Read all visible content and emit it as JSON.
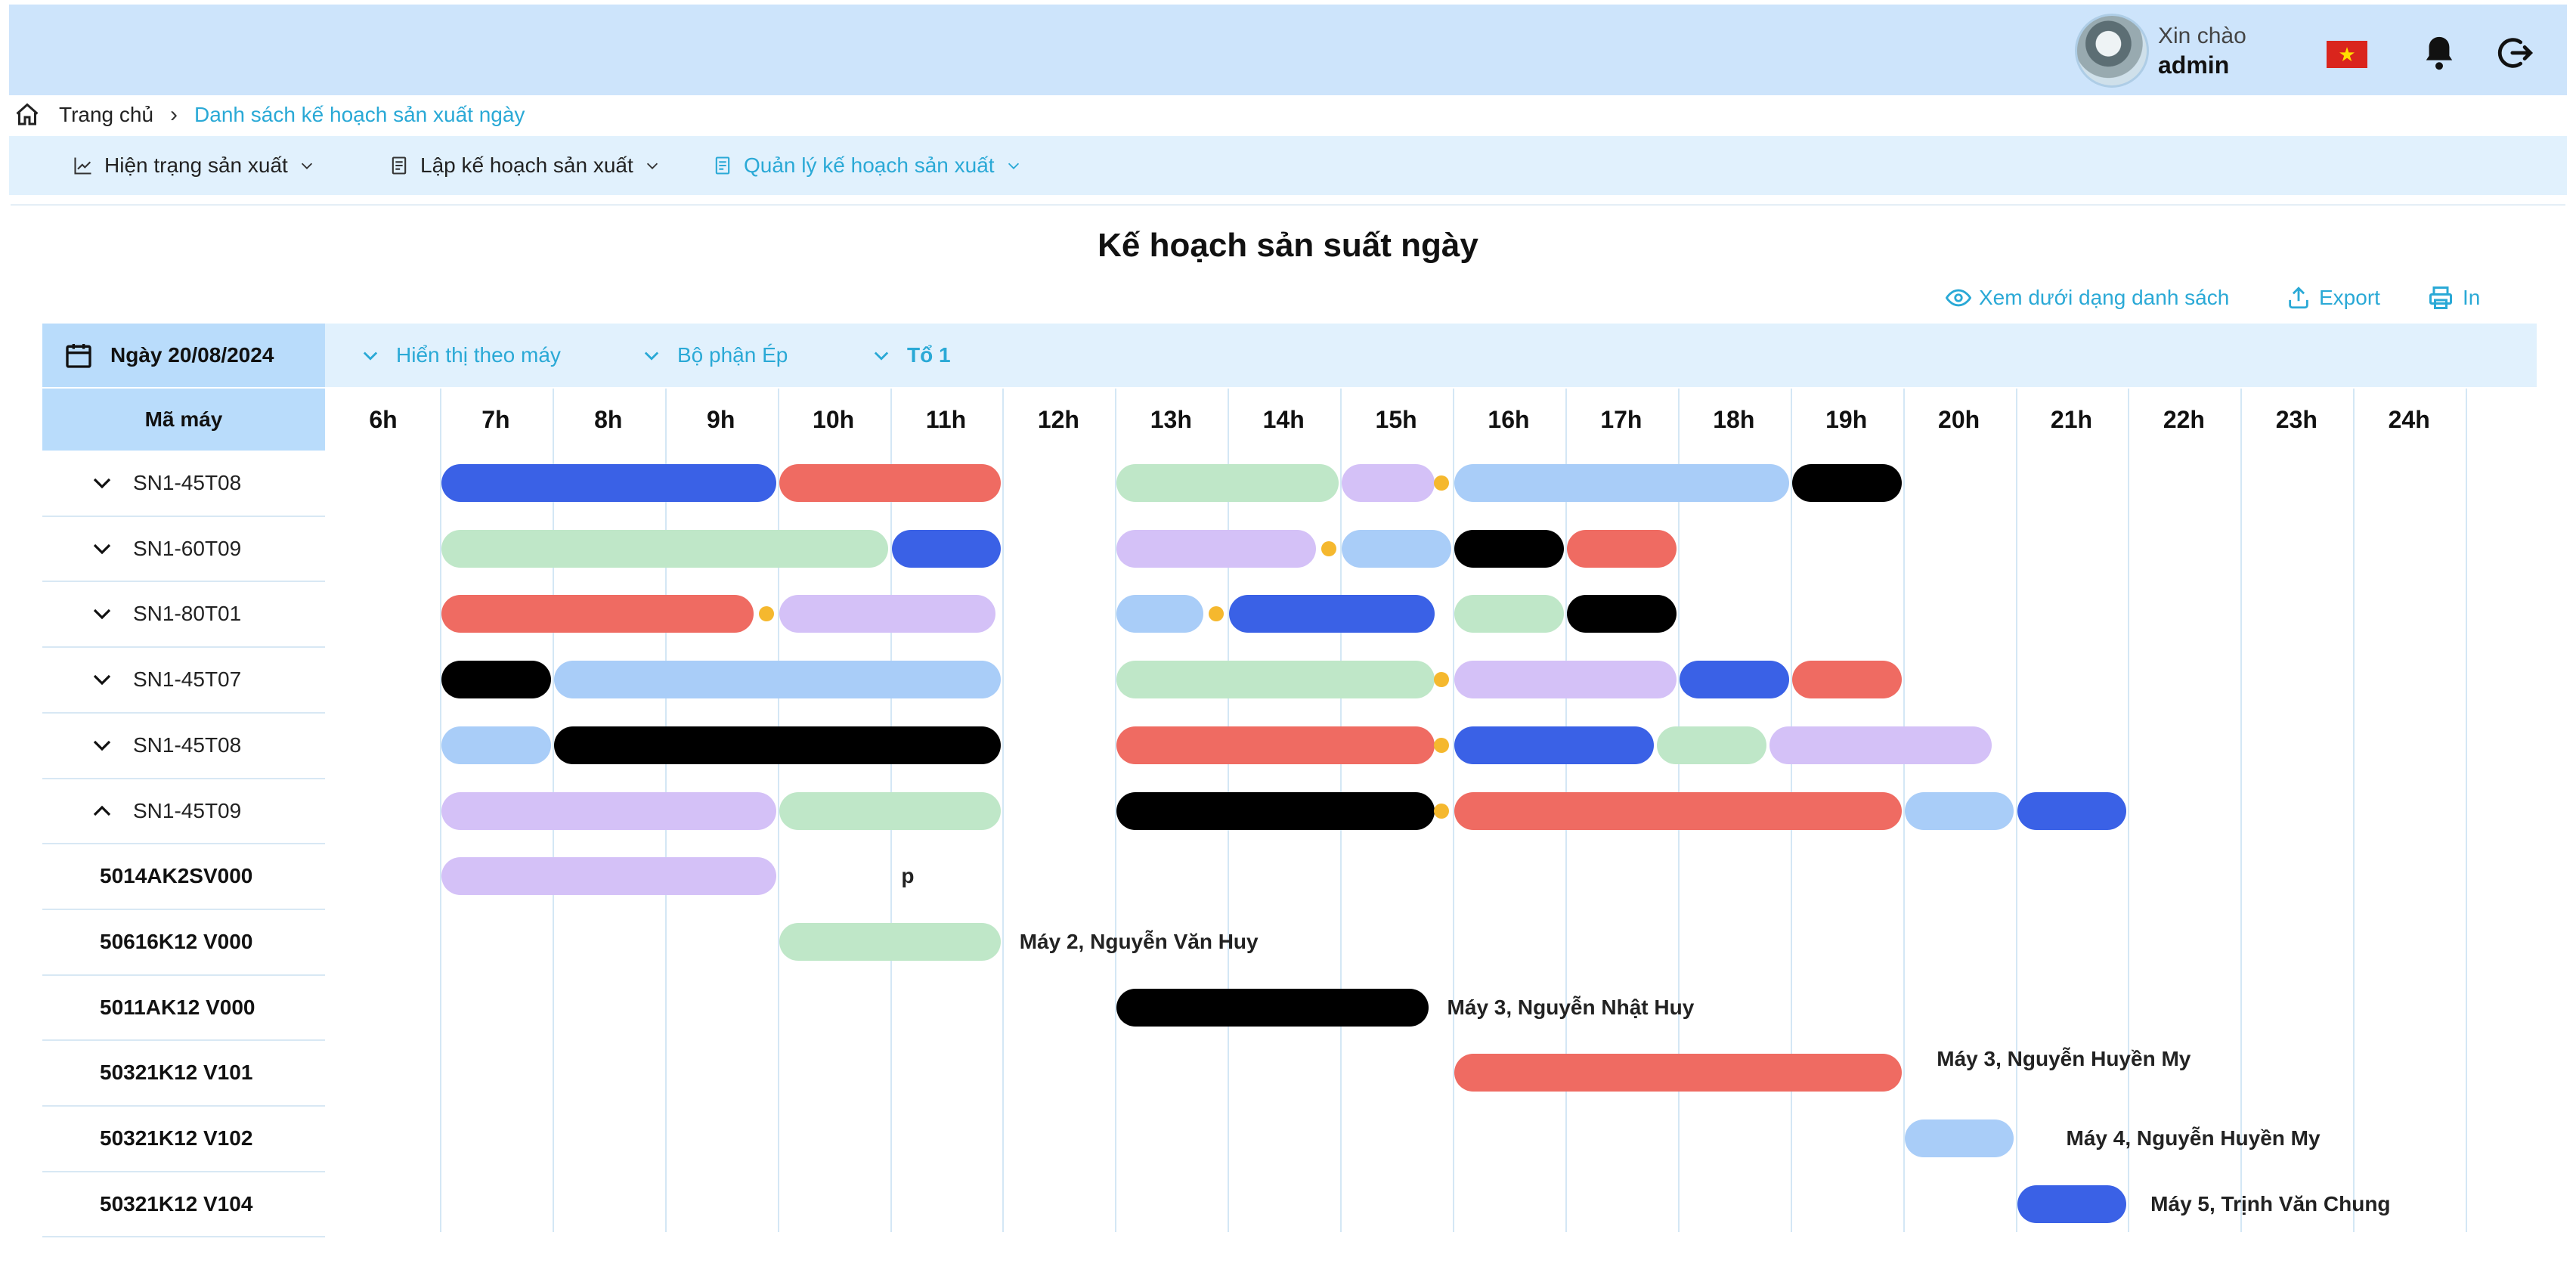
{
  "header": {
    "greeting": "Xin chào",
    "username": "admin",
    "icons": [
      "user-avatar",
      "vietnam-flag-icon",
      "bell-icon",
      "logout-icon"
    ]
  },
  "breadcrumb": {
    "home": "Trang chủ",
    "current": "Danh sách kế hoạch sản xuất ngày"
  },
  "menu": [
    {
      "label": "Hiện trạng sản xuất",
      "icon": "chart-line-icon",
      "active": false
    },
    {
      "label": "Lập kế hoạch sản xuất",
      "icon": "document-icon",
      "active": false
    },
    {
      "label": "Quản lý kế hoạch sản xuất",
      "icon": "document-icon",
      "active": true
    }
  ],
  "page": {
    "title": "Kế hoạch sản suất ngày",
    "actions": {
      "list_view": "Xem dưới dạng danh sách",
      "export": "Export",
      "print": "In"
    }
  },
  "filters": {
    "date": "Ngày 20/08/2024",
    "display": "Hiển thị theo máy",
    "department": "Bộ phận Ép",
    "team": "Tổ 1"
  },
  "grid": {
    "machine_header": "Mã máy",
    "hours": [
      "6h",
      "7h",
      "8h",
      "9h",
      "10h",
      "11h",
      "12h",
      "13h",
      "14h",
      "15h",
      "16h",
      "17h",
      "18h",
      "19h",
      "20h",
      "21h",
      "22h",
      "23h",
      "24h"
    ]
  },
  "colors": {
    "blue": "#3a61e6",
    "red": "#ef6b62",
    "green": "#bfe7c8",
    "purple": "#d4c1f7",
    "lightblue": "#a9cdf8",
    "black": "#000000",
    "dot": "#f5b82e"
  },
  "rows": [
    {
      "label": "SN1-45T08",
      "expanded": false,
      "bars": [
        {
          "start": 7,
          "end": 10,
          "color": "blue"
        },
        {
          "start": 10,
          "end": 12,
          "color": "red"
        },
        {
          "start": 13,
          "end": 15,
          "color": "green"
        },
        {
          "start": 15,
          "end": 15.85,
          "color": "purple"
        },
        {
          "start": 16,
          "end": 19,
          "color": "lightblue"
        },
        {
          "start": 19,
          "end": 20,
          "color": "black"
        }
      ],
      "dots": [
        15.9
      ]
    },
    {
      "label": "SN1-60T09",
      "expanded": false,
      "bars": [
        {
          "start": 7,
          "end": 11,
          "color": "green"
        },
        {
          "start": 11,
          "end": 12,
          "color": "blue"
        },
        {
          "start": 13,
          "end": 14.8,
          "color": "purple"
        },
        {
          "start": 15,
          "end": 16,
          "color": "lightblue"
        },
        {
          "start": 16,
          "end": 17,
          "color": "black"
        },
        {
          "start": 17,
          "end": 18,
          "color": "red"
        }
      ],
      "dots": [
        14.9
      ]
    },
    {
      "label": "SN1-80T01",
      "expanded": false,
      "bars": [
        {
          "start": 7,
          "end": 9.8,
          "color": "red"
        },
        {
          "start": 10,
          "end": 11.95,
          "color": "purple"
        },
        {
          "start": 13,
          "end": 13.8,
          "color": "lightblue"
        },
        {
          "start": 14,
          "end": 15.85,
          "color": "blue"
        },
        {
          "start": 16,
          "end": 17,
          "color": "green"
        },
        {
          "start": 17,
          "end": 18,
          "color": "black"
        }
      ],
      "dots": [
        9.9,
        13.9
      ]
    },
    {
      "label": "SN1-45T07",
      "expanded": false,
      "bars": [
        {
          "start": 7,
          "end": 8,
          "color": "black"
        },
        {
          "start": 8,
          "end": 12,
          "color": "lightblue"
        },
        {
          "start": 13,
          "end": 15.85,
          "color": "green"
        },
        {
          "start": 16,
          "end": 18,
          "color": "purple"
        },
        {
          "start": 18,
          "end": 19,
          "color": "blue"
        },
        {
          "start": 19,
          "end": 20,
          "color": "red"
        }
      ],
      "dots": [
        15.9
      ]
    },
    {
      "label": "SN1-45T08",
      "expanded": false,
      "bars": [
        {
          "start": 7,
          "end": 8,
          "color": "lightblue"
        },
        {
          "start": 8,
          "end": 12,
          "color": "black"
        },
        {
          "start": 13,
          "end": 15.85,
          "color": "red"
        },
        {
          "start": 16,
          "end": 17.8,
          "color": "blue"
        },
        {
          "start": 17.8,
          "end": 18.8,
          "color": "green"
        },
        {
          "start": 18.8,
          "end": 20.8,
          "color": "purple"
        }
      ],
      "dots": [
        15.9
      ]
    },
    {
      "label": "SN1-45T09",
      "expanded": true,
      "bars": [
        {
          "start": 7,
          "end": 10,
          "color": "purple"
        },
        {
          "start": 10,
          "end": 12,
          "color": "green"
        },
        {
          "start": 13,
          "end": 15.85,
          "color": "black"
        },
        {
          "start": 16,
          "end": 20,
          "color": "red"
        },
        {
          "start": 20,
          "end": 21,
          "color": "lightblue"
        },
        {
          "start": 21,
          "end": 22,
          "color": "blue"
        }
      ],
      "dots": [
        15.9
      ]
    },
    {
      "label": "5014AK2SV000",
      "sub": true,
      "bars": [
        {
          "start": 7,
          "end": 10,
          "color": "purple"
        }
      ],
      "annotation": {
        "text": "p",
        "at": 11.1
      }
    },
    {
      "label": "50616K12 V000",
      "sub": true,
      "bars": [
        {
          "start": 10,
          "end": 12,
          "color": "green"
        }
      ],
      "annotation": {
        "text": "Máy 2, Nguyễn Văn Huy",
        "at": 12.15
      }
    },
    {
      "label": "5011AK12 V000",
      "sub": true,
      "bars": [
        {
          "start": 13,
          "end": 15.8,
          "color": "black"
        }
      ],
      "annotation": {
        "text": "Máy 3, Nguyễn Nhật Huy",
        "at": 15.95
      }
    },
    {
      "label": "50321K12 V101",
      "sub": true,
      "bars": [
        {
          "start": 16,
          "end": 20,
          "color": "red"
        }
      ],
      "annotation": {
        "text": "Máy 3, Nguyễn Huyền  My",
        "at": 20.3,
        "above": true
      }
    },
    {
      "label": "50321K12 V102",
      "sub": true,
      "bars": [
        {
          "start": 20,
          "end": 21,
          "color": "lightblue"
        }
      ],
      "annotation": {
        "text": "Máy 4, Nguyễn Huyền  My",
        "at": 21.45
      }
    },
    {
      "label": "50321K12 V104",
      "sub": true,
      "bars": [
        {
          "start": 21,
          "end": 22,
          "color": "blue"
        }
      ],
      "annotation": {
        "text": "Máy 5, Trịnh Văn Chung",
        "at": 22.2
      }
    }
  ]
}
